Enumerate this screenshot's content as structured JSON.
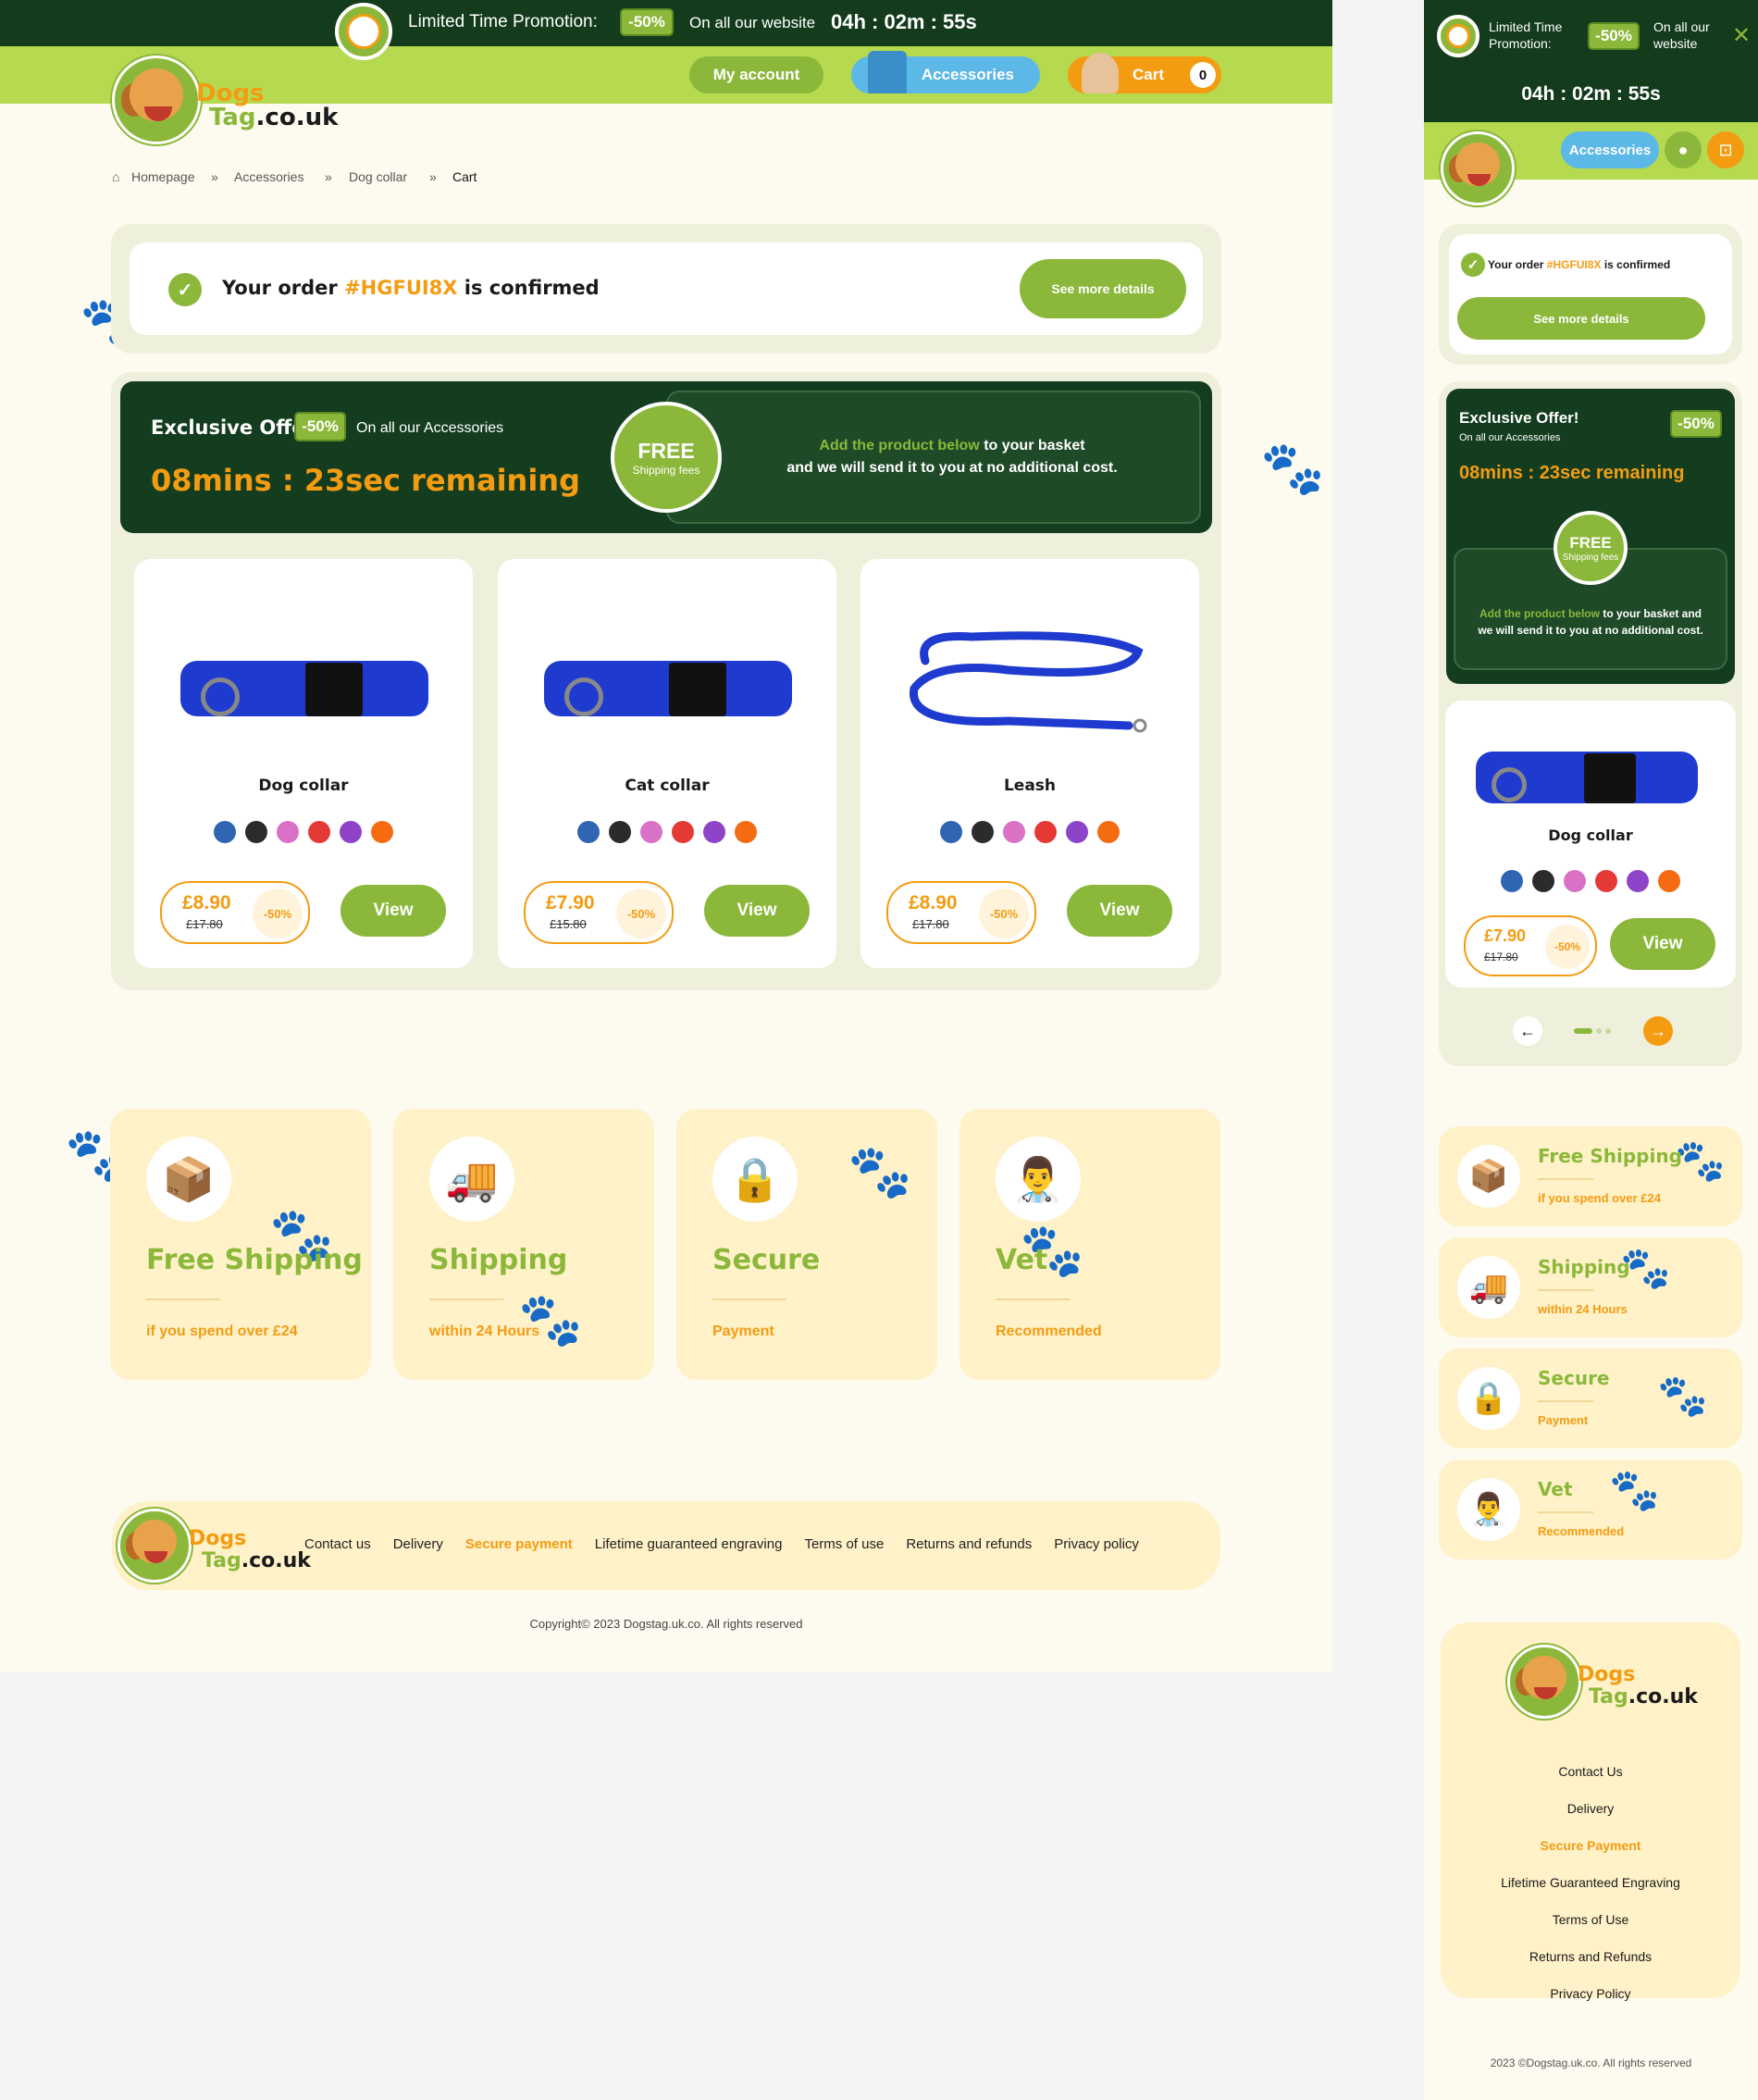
{
  "promo": {
    "label": "Limited Time Promotion:",
    "discount": "-50%",
    "text": "On all our website",
    "timer": "04h : 02m : 55s"
  },
  "nav": {
    "my_account": "My account",
    "accessories": "Accessories",
    "cart": "Cart",
    "cart_count": "0"
  },
  "brand": {
    "word1": "Dogs",
    "word2a": "Tag",
    "word2b": ".co.uk"
  },
  "breadcrumb": {
    "home": "Homepage",
    "sep": "»",
    "c1": "Accessories",
    "c2": "Dog collar",
    "c3": "Cart"
  },
  "order": {
    "prefix": "Your order",
    "code": "#HGFUI8X",
    "suffix": "is confirmed",
    "button": "See more details"
  },
  "offer": {
    "title": "Exclusive Offer!",
    "discount": "-50%",
    "sub": "On all our Accessories",
    "timer": "08mins : 23sec remaining",
    "free": "FREE",
    "free_sub": "Shipping fees",
    "msg_green": "Add the product below",
    "msg_rest": "to your basket",
    "msg_line2": "and we will send it to you at no additional cost.",
    "msg_m1": "to your basket and we will send it to you at no additional cost."
  },
  "products": [
    {
      "name": "Dog collar",
      "price": "£8.90",
      "old": "£17.80",
      "disc": "-50%",
      "button": "View"
    },
    {
      "name": "Cat collar",
      "price": "£7.90",
      "old": "£15.80",
      "disc": "-50%",
      "button": "View"
    },
    {
      "name": "Leash",
      "price": "£8.90",
      "old": "£17.80",
      "disc": "-50%",
      "button": "View"
    }
  ],
  "swatches": [
    "#2f65b1",
    "#2b2b2b",
    "#d971c7",
    "#e53935",
    "#8e44c9",
    "#f46b12"
  ],
  "features": [
    {
      "title": "Free Shipping",
      "sub": "if you spend over £24",
      "icon": "box-icon"
    },
    {
      "title": "Shipping",
      "sub": "within 24 Hours",
      "icon": "truck-icon"
    },
    {
      "title": "Secure",
      "sub": "Payment",
      "icon": "lock-icon"
    },
    {
      "title": "Vet",
      "sub": "Recommended",
      "icon": "vet-icon"
    }
  ],
  "footer": {
    "links": [
      "Contact us",
      "Delivery",
      "Secure payment",
      "Lifetime guaranteed engraving",
      "Terms of use",
      "Returns and refunds",
      "Privacy policy"
    ],
    "copyright": "Copyright© 2023 Dogstag.uk.co. All rights reserved"
  },
  "mobile": {
    "promo_label": "Limited Time Promotion:",
    "promo_disc": "-50%",
    "promo_text": "On all our website",
    "timer": "04h : 02m : 55s",
    "accessories": "Accessories",
    "order_prefix": "Your order",
    "order_code": "#HGFUI8X",
    "order_suffix": "is confirmed",
    "order_button": "See more details",
    "offer_title": "Exclusive Offer!",
    "offer_sub": "On all our Accessories",
    "offer_disc": "-50%",
    "offer_timer": "08mins : 23sec remaining",
    "free": "FREE",
    "free_sub": "Shipping fees",
    "product": {
      "name": "Dog collar",
      "price": "£7.90",
      "old": "£17.80",
      "disc": "-50%",
      "button": "View"
    },
    "footer_links": [
      "Contact Us",
      "Delivery",
      "Secure Payment",
      "Lifetime Guaranteed Engraving",
      "Terms of Use",
      "Returns and Refunds",
      "Privacy Policy"
    ],
    "copyright": "2023 ©Dogstag.uk.co. All rights reserved"
  }
}
